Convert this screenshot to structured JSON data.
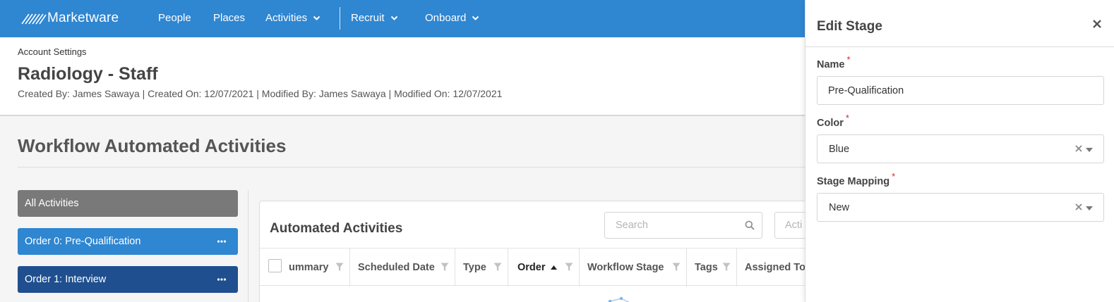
{
  "nav": {
    "brand": "Marketware",
    "items": [
      {
        "label": "People"
      },
      {
        "label": "Places"
      },
      {
        "label": "Activities"
      },
      {
        "label": "Recruit"
      },
      {
        "label": "Onboard"
      }
    ]
  },
  "header": {
    "breadcrumb": "Account Settings",
    "title": "Radiology - Staff",
    "meta": "Created By: James Sawaya | Created On: 12/07/2021 | Modified By: James Sawaya | Modified On: 12/07/2021"
  },
  "section": {
    "title": "Workflow Automated Activities"
  },
  "stages": [
    {
      "label": "All Activities"
    },
    {
      "label": "Order 0: Pre-Qualification"
    },
    {
      "label": "Order 1: Interview"
    }
  ],
  "panel": {
    "title": "Automated Activities",
    "search_placeholder": "Search",
    "activity_filter_placeholder": "Acti",
    "columns": [
      {
        "label": "ummary"
      },
      {
        "label": "Scheduled Date"
      },
      {
        "label": "Type"
      },
      {
        "label": "Order"
      },
      {
        "label": "Workflow Stage"
      },
      {
        "label": "Tags"
      },
      {
        "label": "Assigned To"
      }
    ]
  },
  "drawer": {
    "title": "Edit Stage",
    "name_label": "Name",
    "name_value": "Pre-Qualification",
    "color_label": "Color",
    "color_value": "Blue",
    "mapping_label": "Stage Mapping",
    "mapping_value": "New",
    "required_mark": "*"
  },
  "colors": {
    "nav_bg": "#2f86d1",
    "stage_active": "#2f86d1",
    "stage_dark": "#1f4f8f",
    "stage_all": "#797979",
    "required": "#d12b2b"
  }
}
